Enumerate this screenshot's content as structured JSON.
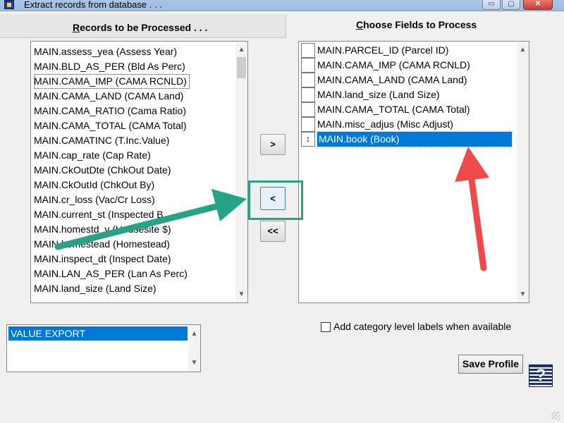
{
  "window": {
    "title": "Extract records from database . . .",
    "controls": {
      "minimize": "▭",
      "maximize": "▢",
      "close": "✕"
    }
  },
  "records_panel": {
    "header_prefix": "",
    "header_underlined": "R",
    "header_rest": "ecords to be Processed . . .",
    "items": [
      "MAIN.assess_yea (Assess Year)",
      "MAIN.BLD_AS_PER (Bld As Perc)",
      "MAIN.CAMA_IMP (CAMA RCNLD)",
      "MAIN.CAMA_LAND (CAMA Land)",
      "MAIN.CAMA_RATIO (Cama Ratio)",
      "MAIN.CAMA_TOTAL (CAMA Total)",
      "MAIN.CAMATINC (T.Inc.Value)",
      "MAIN.cap_rate (Cap Rate)",
      "MAIN.CkOutDte (ChkOut Date)",
      "MAIN.CkOutId (ChkOut By)",
      "MAIN.cr_loss (Vac/Cr Loss)",
      "MAIN.current_st (Inspected B",
      "MAIN.homestd_v (Housesite $)",
      "MAIN.homestead (Homestead)",
      "MAIN.inspect_dt (Inspect Date)",
      "MAIN.LAN_AS_PER (Lan As Perc)",
      "MAIN.land_size (Land Size)"
    ]
  },
  "fields_panel": {
    "header_underlined": "C",
    "header_rest": "hoose Fields to Process",
    "items": [
      "MAIN.PARCEL_ID (Parcel ID)",
      "MAIN.CAMA_IMP (CAMA RCNLD)",
      "MAIN.CAMA_LAND (CAMA Land)",
      "MAIN.land_size (Land Size)",
      "MAIN.CAMA_TOTAL (CAMA Total)",
      "MAIN.misc_adjus (Misc Adjust)",
      "MAIN.book (Book)"
    ],
    "selected_index": 6,
    "sizer_glyph": "↕"
  },
  "transfer_buttons": {
    "add": ">",
    "remove": "<",
    "remove_all": "<<"
  },
  "profiles": {
    "items": [
      "VALUE EXPORT"
    ]
  },
  "category_labels_checkbox": {
    "label": "Add category level labels when available",
    "checked": false
  },
  "save_profile_label": "Save Profile",
  "help_glyph": "?",
  "scroll": {
    "up": "▲",
    "down": "▼"
  },
  "annotation_colors": {
    "teal_arrow": "#26a386",
    "red_arrow": "#ef4a4a"
  }
}
